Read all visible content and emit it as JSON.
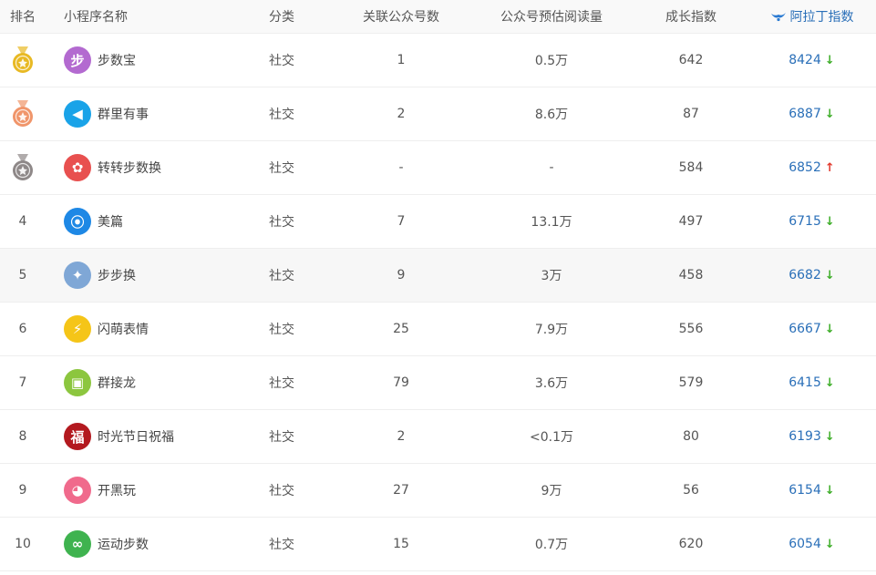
{
  "header": {
    "rank": "排名",
    "name": "小程序名称",
    "category": "分类",
    "publics": "关联公众号数",
    "reads": "公众号预估阅读量",
    "growth": "成长指数",
    "index": "阿拉丁指数"
  },
  "rows": [
    {
      "rank": "",
      "medal": "gold",
      "icon": "step-icon",
      "icon_color": "#b36ad0",
      "icon_glyph": "步",
      "name": "步数宝",
      "category": "社交",
      "publics": "1",
      "reads": "0.5万",
      "growth": "642",
      "index": "8424",
      "trend": "down"
    },
    {
      "rank": "",
      "medal": "bronze",
      "icon": "megaphone-icon",
      "icon_color": "#1aa3e8",
      "icon_glyph": "◀",
      "name": "群里有事",
      "category": "社交",
      "publics": "2",
      "reads": "8.6万",
      "growth": "87",
      "index": "6887",
      "trend": "down"
    },
    {
      "rank": "",
      "medal": "silver",
      "icon": "bear-icon",
      "icon_color": "#e8504f",
      "icon_glyph": "✿",
      "name": "转转步数换",
      "category": "社交",
      "publics": "-",
      "reads": "-",
      "growth": "584",
      "index": "6852",
      "trend": "up"
    },
    {
      "rank": "4",
      "medal": "",
      "icon": "meipian-icon",
      "icon_color": "#1e88e5",
      "icon_glyph": "⦿",
      "name": "美篇",
      "category": "社交",
      "publics": "7",
      "reads": "13.1万",
      "growth": "497",
      "index": "6715",
      "trend": "down"
    },
    {
      "rank": "5",
      "medal": "",
      "icon": "shoe-icon",
      "icon_color": "#7fa7d6",
      "icon_glyph": "✦",
      "name": "步步换",
      "category": "社交",
      "publics": "9",
      "reads": "3万",
      "growth": "458",
      "index": "6682",
      "trend": "down"
    },
    {
      "rank": "6",
      "medal": "",
      "icon": "lightning-icon",
      "icon_color": "#f5c518",
      "icon_glyph": "⚡",
      "name": "闪萌表情",
      "category": "社交",
      "publics": "25",
      "reads": "7.9万",
      "growth": "556",
      "index": "6667",
      "trend": "down"
    },
    {
      "rank": "7",
      "medal": "",
      "icon": "chat-bubbles-icon",
      "icon_color": "#8cc63f",
      "icon_glyph": "▣",
      "name": "群接龙",
      "category": "社交",
      "publics": "79",
      "reads": "3.6万",
      "growth": "579",
      "index": "6415",
      "trend": "down"
    },
    {
      "rank": "8",
      "medal": "",
      "icon": "blessing-icon",
      "icon_color": "#b3191f",
      "icon_glyph": "福",
      "name": "时光节日祝福",
      "category": "社交",
      "publics": "2",
      "reads": "<0.1万",
      "growth": "80",
      "index": "6193",
      "trend": "down"
    },
    {
      "rank": "9",
      "medal": "",
      "icon": "game-chat-icon",
      "icon_color": "#f06a8c",
      "icon_glyph": "◕",
      "name": "开黑玩",
      "category": "社交",
      "publics": "27",
      "reads": "9万",
      "growth": "56",
      "index": "6154",
      "trend": "down"
    },
    {
      "rank": "10",
      "medal": "",
      "icon": "footprint-icon",
      "icon_color": "#3fb34f",
      "icon_glyph": "∞",
      "name": "运动步数",
      "category": "社交",
      "publics": "15",
      "reads": "0.7万",
      "growth": "620",
      "index": "6054",
      "trend": "down"
    }
  ],
  "colors": {
    "gold": "#e8b923",
    "silver": "#8e8888",
    "bronze": "#f0956a"
  }
}
